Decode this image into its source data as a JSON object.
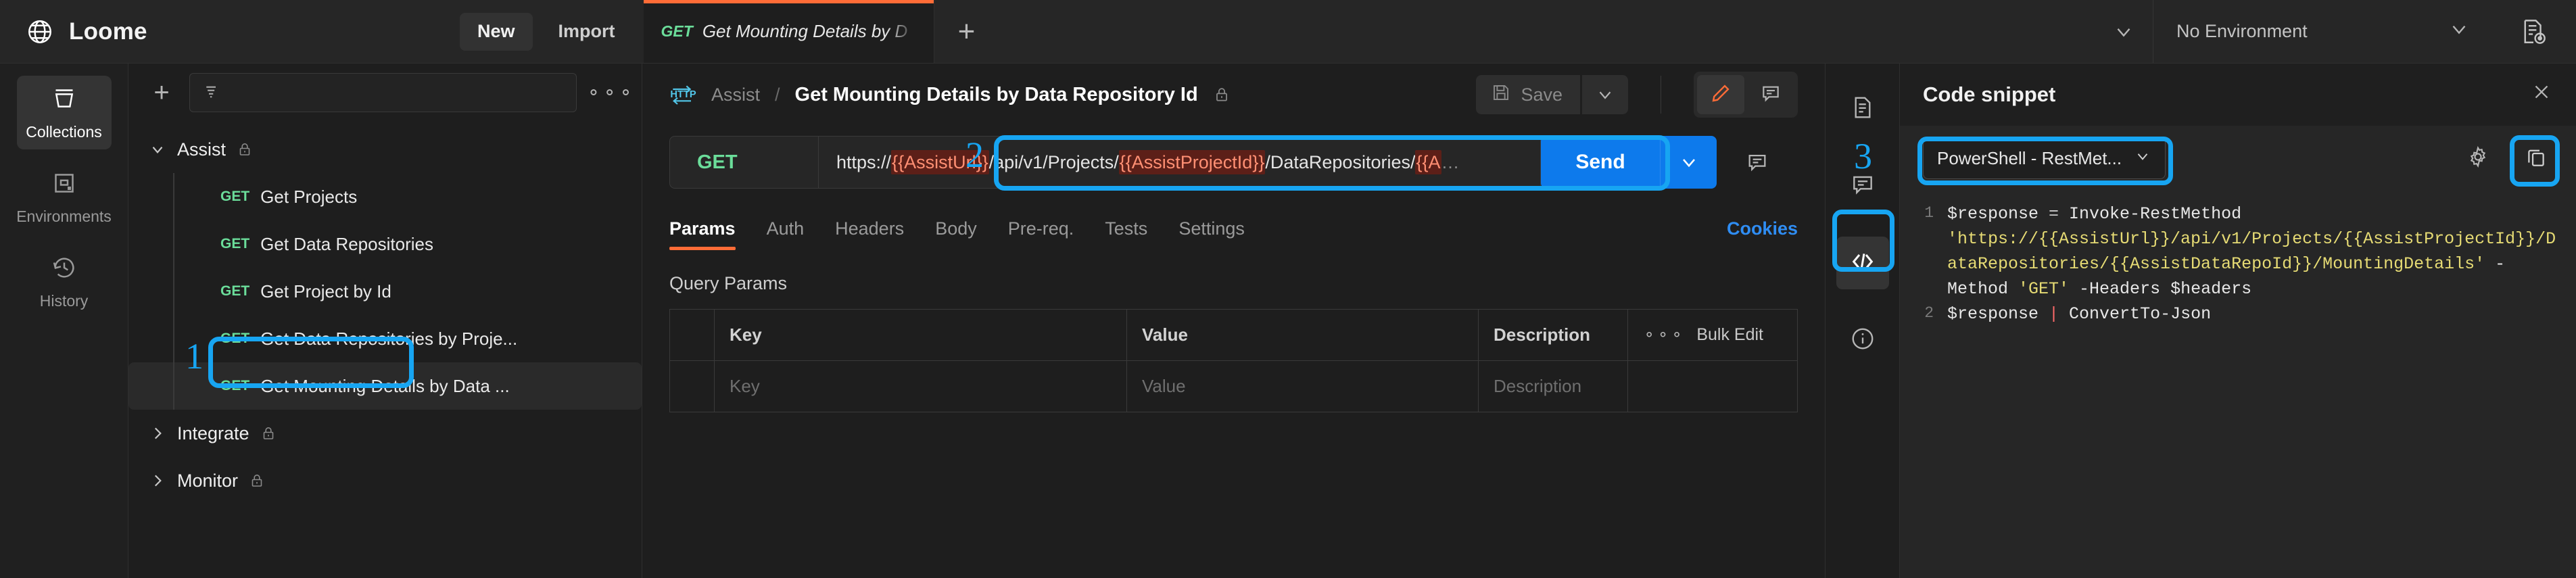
{
  "brand": {
    "name": "Loome",
    "icon": "globe-icon"
  },
  "topbar": {
    "new_label": "New",
    "import_label": "Import",
    "tab": {
      "method": "GET",
      "title": "Get Mounting Details by D"
    },
    "new_tab_icon": "plus-icon",
    "tabs_caret_icon": "chevron-down-icon",
    "environment_label": "No Environment",
    "environment_caret_icon": "chevron-down-icon",
    "env_quicklook_icon": "environment-quicklook-icon"
  },
  "rail": {
    "items": [
      {
        "label": "Collections",
        "icon": "collections-icon",
        "active": true
      },
      {
        "label": "Environments",
        "icon": "environments-icon",
        "active": false
      },
      {
        "label": "History",
        "icon": "history-icon",
        "active": false
      }
    ]
  },
  "sidebar": {
    "add_icon": "plus-icon",
    "filter_icon": "filter-icon",
    "search_placeholder": "",
    "more_icon": "ellipsis-icon",
    "groups": [
      {
        "name": "Assist",
        "expanded": true,
        "lock_icon": "lock-icon",
        "requests": [
          {
            "method": "GET",
            "name": "Get Projects",
            "selected": false
          },
          {
            "method": "GET",
            "name": "Get Data Repositories",
            "selected": false
          },
          {
            "method": "GET",
            "name": "Get Project by Id",
            "selected": false
          },
          {
            "method": "GET",
            "name": "Get Data Repositories by Proje...",
            "selected": false
          },
          {
            "method": "GET",
            "name": "Get Mounting Details by Data ...",
            "selected": true
          }
        ]
      },
      {
        "name": "Integrate",
        "expanded": false,
        "lock_icon": "lock-icon",
        "requests": []
      },
      {
        "name": "Monitor",
        "expanded": false,
        "lock_icon": "lock-icon",
        "requests": []
      }
    ]
  },
  "request": {
    "breadcrumb_icon": "http-icon",
    "breadcrumb_root": "Assist",
    "breadcrumb_sep": "/",
    "breadcrumb_current": "Get Mounting Details by Data Repository Id",
    "lock_icon": "lock-icon",
    "save_label": "Save",
    "save_icon": "floppy-disk-icon",
    "save_caret_icon": "chevron-down-icon",
    "edit_icon": "pencil-icon",
    "comment_icon": "comment-icon",
    "method": "GET",
    "url_parts": [
      {
        "text": "https://",
        "type": "plain"
      },
      {
        "text": "{{AssistUrl}}",
        "type": "variable"
      },
      {
        "text": "/api/v1/Projects/",
        "type": "plain"
      },
      {
        "text": "{{AssistProjectId}}",
        "type": "variable"
      },
      {
        "text": "/DataRepositories/",
        "type": "plain"
      },
      {
        "text": "{{A",
        "type": "variable"
      },
      {
        "text": "…",
        "type": "ellipsis"
      }
    ],
    "send_label": "Send",
    "send_caret_icon": "chevron-down-icon",
    "url_comment_icon": "comment-icon",
    "tabs": [
      {
        "label": "Params",
        "active": true
      },
      {
        "label": "Auth",
        "active": false
      },
      {
        "label": "Headers",
        "active": false
      },
      {
        "label": "Body",
        "active": false
      },
      {
        "label": "Pre-req.",
        "active": false
      },
      {
        "label": "Tests",
        "active": false
      },
      {
        "label": "Settings",
        "active": false
      }
    ],
    "cookies_label": "Cookies",
    "query_params_title": "Query Params",
    "table": {
      "headers": [
        "Key",
        "Value",
        "Description"
      ],
      "bulk_edit_label": "Bulk Edit",
      "bulk_more_icon": "ellipsis-icon",
      "empty_row": [
        "Key",
        "Value",
        "Description"
      ]
    }
  },
  "right_rail": {
    "items": [
      {
        "icon": "documentation-icon",
        "active": false
      },
      {
        "icon": "comment-icon",
        "active": false
      },
      {
        "icon": "code-icon",
        "active": true
      },
      {
        "icon": "info-icon",
        "active": false
      }
    ]
  },
  "code_panel": {
    "title": "Code snippet",
    "close_icon": "close-icon",
    "language": "PowerShell - RestMet...",
    "language_caret_icon": "chevron-down-icon",
    "settings_icon": "gear-icon",
    "copy_icon": "copy-icon",
    "lines": [
      {
        "number": "1",
        "tokens": [
          {
            "t": "$response ",
            "c": "var"
          },
          {
            "t": "= ",
            "c": "op"
          },
          {
            "t": "Invoke-RestMethod ",
            "c": "fn"
          },
          {
            "t": "'https://{{AssistUrl}}/api/v1/Projects/{{AssistProjectId}}/DataRepositories/{{AssistDataRepoId}}/MountingDetails'",
            "c": "str"
          },
          {
            "t": " -Method ",
            "c": "fn"
          },
          {
            "t": "'GET'",
            "c": "str"
          },
          {
            "t": " -Headers $headers",
            "c": "fn"
          }
        ]
      },
      {
        "number": "2",
        "tokens": [
          {
            "t": "$response ",
            "c": "var"
          },
          {
            "t": "| ",
            "c": "pipe"
          },
          {
            "t": "ConvertTo-Json",
            "c": "fn"
          }
        ]
      }
    ]
  },
  "annotations": [
    {
      "number": "1",
      "target": "selected-request-in-sidebar"
    },
    {
      "number": "2",
      "target": "request-url-field"
    },
    {
      "number": "3",
      "target": "code-snippet-button"
    }
  ],
  "colors": {
    "accent_orange": "#ff6c37",
    "send_blue": "#0d7aec",
    "method_green": "#6bdd9a",
    "highlight_blue": "#17a5f2",
    "variable_bg": "#5c1f18",
    "variable_fg": "#ff8f73",
    "code_string": "#e6db74"
  }
}
